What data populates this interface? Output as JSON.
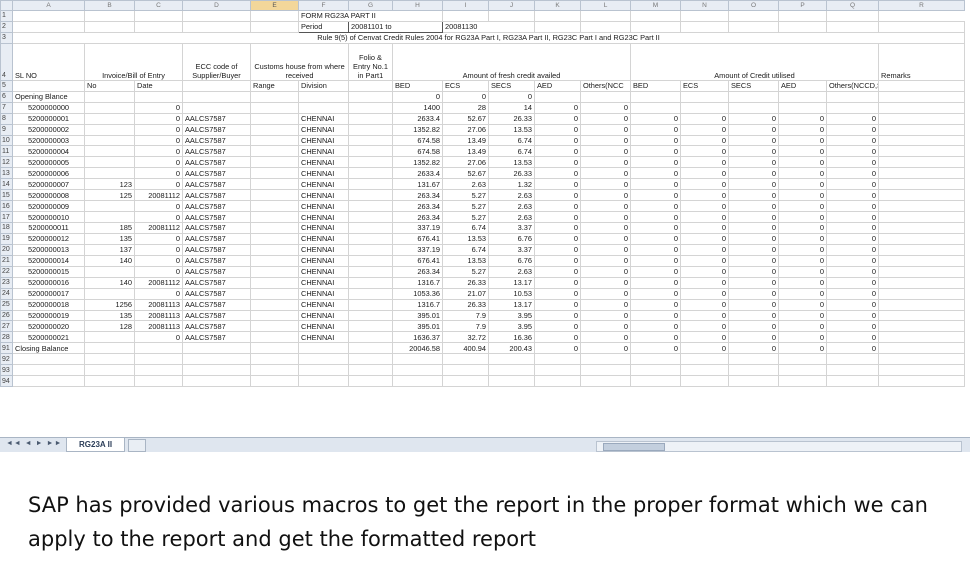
{
  "columns": [
    "",
    "A",
    "B",
    "C",
    "D",
    "E",
    "F",
    "G",
    "H",
    "I",
    "J",
    "K",
    "L",
    "M",
    "N",
    "O",
    "P",
    "Q",
    "R"
  ],
  "selected_column": "E",
  "title_rows": {
    "form": "FORM RG23A PART II",
    "period_label": "Period",
    "period_from": "20081101  to",
    "period_to": "20081130",
    "rule_text": "Rule 9(5) of Cenvat Credit Rules 2004 for RG23A Part I, RG23A Part II, RG23C Part I and RG23C Part II"
  },
  "header4": {
    "slno": "SL NO",
    "invoice": "Invoice/Bill of Entry",
    "ecc": "ECC code of Supplier/Buyer",
    "customs": "Customs house from where received",
    "folio": "Folio & Entry No.1 in Part1",
    "fresh": "Amount of fresh credit availed",
    "utilised": "Amount of Credit utilised",
    "remarks": "Remarks"
  },
  "header5": [
    "No",
    "Date",
    "",
    "Range",
    "Division",
    "",
    "BED",
    "ECS",
    "SECS",
    "AED",
    "Others(NCC",
    "BED",
    "ECS",
    "SECS",
    "AED",
    "Others(NCCD,SED)"
  ],
  "rows": [
    {
      "n": "6",
      "c": [
        "Opening Blance",
        "",
        "",
        "",
        "",
        "",
        "",
        "0",
        "0",
        "0",
        "",
        "",
        "",
        "",
        "",
        "",
        "",
        ""
      ]
    },
    {
      "n": "7",
      "c": [
        "5200000000",
        "",
        "0",
        "",
        "",
        "",
        "",
        "1400",
        "28",
        "14",
        "0",
        "0",
        "",
        "",
        "",
        "",
        "",
        ""
      ]
    },
    {
      "n": "8",
      "c": [
        "5200000001",
        "",
        "0",
        "AALCS7587",
        "",
        "CHENNAI",
        "",
        "2633.4",
        "52.67",
        "26.33",
        "0",
        "0",
        "0",
        "0",
        "0",
        "0",
        "0",
        ""
      ]
    },
    {
      "n": "9",
      "c": [
        "5200000002",
        "",
        "0",
        "AALCS7587",
        "",
        "CHENNAI",
        "",
        "1352.82",
        "27.06",
        "13.53",
        "0",
        "0",
        "0",
        "0",
        "0",
        "0",
        "0",
        ""
      ]
    },
    {
      "n": "10",
      "c": [
        "5200000003",
        "",
        "0",
        "AALCS7587",
        "",
        "CHENNAI",
        "",
        "674.58",
        "13.49",
        "6.74",
        "0",
        "0",
        "0",
        "0",
        "0",
        "0",
        "0",
        ""
      ]
    },
    {
      "n": "11",
      "c": [
        "5200000004",
        "",
        "0",
        "AALCS7587",
        "",
        "CHENNAI",
        "",
        "674.58",
        "13.49",
        "6.74",
        "0",
        "0",
        "0",
        "0",
        "0",
        "0",
        "0",
        ""
      ]
    },
    {
      "n": "12",
      "c": [
        "5200000005",
        "",
        "0",
        "AALCS7587",
        "",
        "CHENNAI",
        "",
        "1352.82",
        "27.06",
        "13.53",
        "0",
        "0",
        "0",
        "0",
        "0",
        "0",
        "0",
        ""
      ]
    },
    {
      "n": "13",
      "c": [
        "5200000006",
        "",
        "0",
        "AALCS7587",
        "",
        "CHENNAI",
        "",
        "2633.4",
        "52.67",
        "26.33",
        "0",
        "0",
        "0",
        "0",
        "0",
        "0",
        "0",
        ""
      ]
    },
    {
      "n": "14",
      "c": [
        "5200000007",
        "123",
        "0",
        "AALCS7587",
        "",
        "CHENNAI",
        "",
        "131.67",
        "2.63",
        "1.32",
        "0",
        "0",
        "0",
        "0",
        "0",
        "0",
        "0",
        ""
      ]
    },
    {
      "n": "15",
      "c": [
        "5200000008",
        "125",
        "20081112",
        "AALCS7587",
        "",
        "CHENNAI",
        "",
        "263.34",
        "5.27",
        "2.63",
        "0",
        "0",
        "0",
        "0",
        "0",
        "0",
        "0",
        ""
      ]
    },
    {
      "n": "16",
      "c": [
        "5200000009",
        "",
        "0",
        "AALCS7587",
        "",
        "CHENNAI",
        "",
        "263.34",
        "5.27",
        "2.63",
        "0",
        "0",
        "0",
        "0",
        "0",
        "0",
        "0",
        ""
      ]
    },
    {
      "n": "17",
      "c": [
        "5200000010",
        "",
        "0",
        "AALCS7587",
        "",
        "CHENNAI",
        "",
        "263.34",
        "5.27",
        "2.63",
        "0",
        "0",
        "0",
        "0",
        "0",
        "0",
        "0",
        ""
      ]
    },
    {
      "n": "18",
      "c": [
        "5200000011",
        "185",
        "20081112",
        "AALCS7587",
        "",
        "CHENNAI",
        "",
        "337.19",
        "6.74",
        "3.37",
        "0",
        "0",
        "0",
        "0",
        "0",
        "0",
        "0",
        ""
      ]
    },
    {
      "n": "19",
      "c": [
        "5200000012",
        "135",
        "0",
        "AALCS7587",
        "",
        "CHENNAI",
        "",
        "676.41",
        "13.53",
        "6.76",
        "0",
        "0",
        "0",
        "0",
        "0",
        "0",
        "0",
        ""
      ]
    },
    {
      "n": "20",
      "c": [
        "5200000013",
        "137",
        "0",
        "AALCS7587",
        "",
        "CHENNAI",
        "",
        "337.19",
        "6.74",
        "3.37",
        "0",
        "0",
        "0",
        "0",
        "0",
        "0",
        "0",
        ""
      ]
    },
    {
      "n": "21",
      "c": [
        "5200000014",
        "140",
        "0",
        "AALCS7587",
        "",
        "CHENNAI",
        "",
        "676.41",
        "13.53",
        "6.76",
        "0",
        "0",
        "0",
        "0",
        "0",
        "0",
        "0",
        ""
      ]
    },
    {
      "n": "22",
      "c": [
        "5200000015",
        "",
        "0",
        "AALCS7587",
        "",
        "CHENNAI",
        "",
        "263.34",
        "5.27",
        "2.63",
        "0",
        "0",
        "0",
        "0",
        "0",
        "0",
        "0",
        ""
      ]
    },
    {
      "n": "23",
      "c": [
        "5200000016",
        "140",
        "20081112",
        "AALCS7587",
        "",
        "CHENNAI",
        "",
        "1316.7",
        "26.33",
        "13.17",
        "0",
        "0",
        "0",
        "0",
        "0",
        "0",
        "0",
        ""
      ]
    },
    {
      "n": "24",
      "c": [
        "5200000017",
        "",
        "0",
        "AALCS7587",
        "",
        "CHENNAI",
        "",
        "1053.36",
        "21.07",
        "10.53",
        "0",
        "0",
        "0",
        "0",
        "0",
        "0",
        "0",
        ""
      ]
    },
    {
      "n": "25",
      "c": [
        "5200000018",
        "1256",
        "20081113",
        "AALCS7587",
        "",
        "CHENNAI",
        "",
        "1316.7",
        "26.33",
        "13.17",
        "0",
        "0",
        "0",
        "0",
        "0",
        "0",
        "0",
        ""
      ]
    },
    {
      "n": "26",
      "c": [
        "5200000019",
        "135",
        "20081113",
        "AALCS7587",
        "",
        "CHENNAI",
        "",
        "395.01",
        "7.9",
        "3.95",
        "0",
        "0",
        "0",
        "0",
        "0",
        "0",
        "0",
        ""
      ]
    },
    {
      "n": "27",
      "c": [
        "5200000020",
        "128",
        "20081113",
        "AALCS7587",
        "",
        "CHENNAI",
        "",
        "395.01",
        "7.9",
        "3.95",
        "0",
        "0",
        "0",
        "0",
        "0",
        "0",
        "0",
        ""
      ]
    },
    {
      "n": "28",
      "c": [
        "5200000021",
        "",
        "0",
        "AALCS7587",
        "",
        "CHENNAI",
        "",
        "1636.37",
        "32.72",
        "16.36",
        "0",
        "0",
        "0",
        "0",
        "0",
        "0",
        "0",
        ""
      ]
    },
    {
      "n": "91",
      "c": [
        "Closing Balance",
        "",
        "",
        "",
        "",
        "",
        "",
        "20046.58",
        "400.94",
        "200.43",
        "0",
        "0",
        "0",
        "0",
        "0",
        "0",
        "0",
        ""
      ]
    },
    {
      "n": "92",
      "c": [
        "",
        "",
        "",
        "",
        "",
        "",
        "",
        "",
        "",
        "",
        "",
        "",
        "",
        "",
        "",
        "",
        "",
        ""
      ]
    },
    {
      "n": "93",
      "c": [
        "",
        "",
        "",
        "",
        "",
        "",
        "",
        "",
        "",
        "",
        "",
        "",
        "",
        "",
        "",
        "",
        "",
        ""
      ]
    },
    {
      "n": "94",
      "c": [
        "",
        "",
        "",
        "",
        "",
        "",
        "",
        "",
        "",
        "",
        "",
        "",
        "",
        "",
        "",
        "",
        "",
        ""
      ]
    }
  ],
  "sheet_tab": "RG23A II",
  "tab_nav": "◄◄ ◄ ► ►►",
  "caption": "SAP has provided various macros to get the report in the proper format which we can apply to the report and get the formatted report"
}
